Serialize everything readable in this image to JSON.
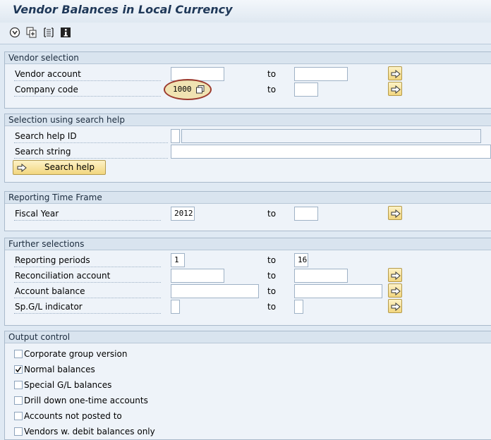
{
  "window": {
    "title": "Vendor Balances in Local Currency"
  },
  "toolbar": {
    "icons": [
      "execute-icon",
      "copy-variant-icon",
      "selection-list-icon",
      "info-icon"
    ]
  },
  "vendor_selection": {
    "header": "Vendor selection",
    "vendor_account": {
      "label": "Vendor account",
      "from": "",
      "to_label": "to",
      "to": ""
    },
    "company_code": {
      "label": "Company code",
      "from": "1000",
      "to_label": "to",
      "to": ""
    }
  },
  "search_help": {
    "header": "Selection using search help",
    "search_help_id": {
      "label": "Search help ID",
      "value": "",
      "description": ""
    },
    "search_string": {
      "label": "Search string",
      "value": ""
    },
    "button_label": "Search help"
  },
  "reporting_time_frame": {
    "header": "Reporting Time Frame",
    "fiscal_year": {
      "label": "Fiscal Year",
      "from": "2012",
      "to_label": "to",
      "to": ""
    }
  },
  "further_selections": {
    "header": "Further selections",
    "reporting_periods": {
      "label": "Reporting periods",
      "from": "1",
      "to_label": "to",
      "to": "16"
    },
    "reconciliation_account": {
      "label": "Reconciliation account",
      "from": "",
      "to_label": "to",
      "to": ""
    },
    "account_balance": {
      "label": "Account balance",
      "from": "",
      "to_label": "to",
      "to": ""
    },
    "spgl_indicator": {
      "label": "Sp.G/L indicator",
      "from": "",
      "to_label": "to",
      "to": ""
    }
  },
  "output_control": {
    "header": "Output control",
    "options": [
      {
        "label": "Corporate group version",
        "checked": false
      },
      {
        "label": "Normal balances",
        "checked": true
      },
      {
        "label": "Special G/L balances",
        "checked": false
      },
      {
        "label": "Drill down one-time accounts",
        "checked": false
      },
      {
        "label": "Accounts not posted to",
        "checked": false
      },
      {
        "label": "Vendors w. debit balances only",
        "checked": false
      }
    ]
  }
}
